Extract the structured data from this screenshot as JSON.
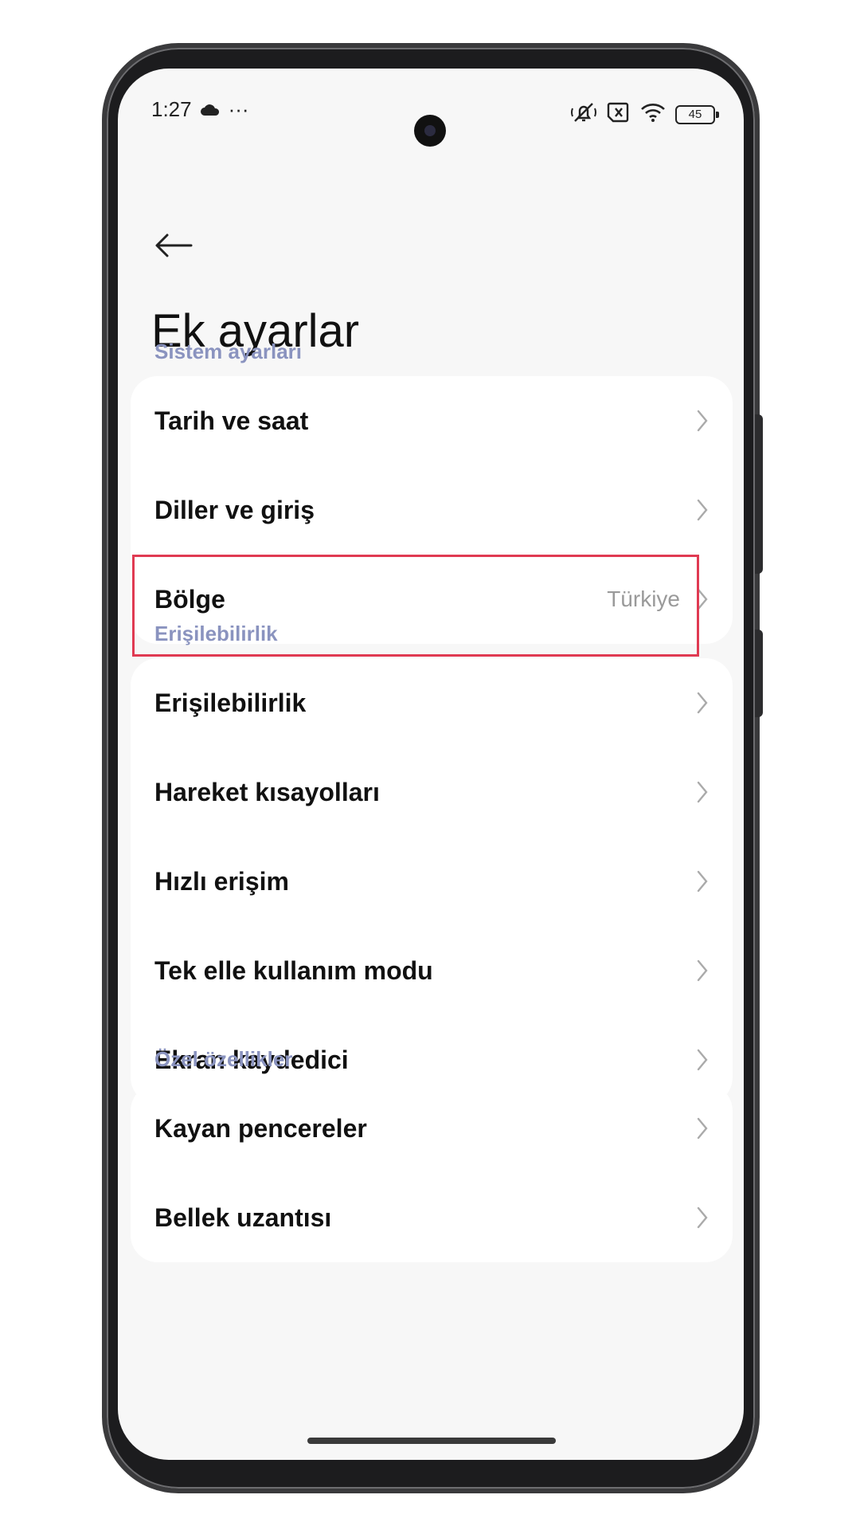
{
  "status_bar": {
    "time": "1:27",
    "more": "···",
    "battery_level": "45"
  },
  "header": {
    "title": "Ek ayarlar"
  },
  "sections": [
    {
      "label": "Sistem ayarları",
      "items": [
        {
          "label": "Tarih ve saat",
          "value": ""
        },
        {
          "label": "Diller ve giriş",
          "value": ""
        },
        {
          "label": "Bölge",
          "value": "Türkiye"
        }
      ]
    },
    {
      "label": "Erişilebilirlik",
      "items": [
        {
          "label": "Erişilebilirlik",
          "value": ""
        },
        {
          "label": "Hareket kısayolları",
          "value": ""
        },
        {
          "label": "Hızlı erişim",
          "value": ""
        },
        {
          "label": "Tek elle kullanım modu",
          "value": ""
        },
        {
          "label": "Ekran kaydedici",
          "value": ""
        }
      ]
    },
    {
      "label": "Özel özellikler",
      "items": [
        {
          "label": "Kayan pencereler",
          "value": ""
        },
        {
          "label": "Bellek uzantısı",
          "value": ""
        }
      ]
    }
  ],
  "colors": {
    "section_label": "#8a93bf",
    "highlight": "#e03a52",
    "background": "#f7f7f7"
  }
}
